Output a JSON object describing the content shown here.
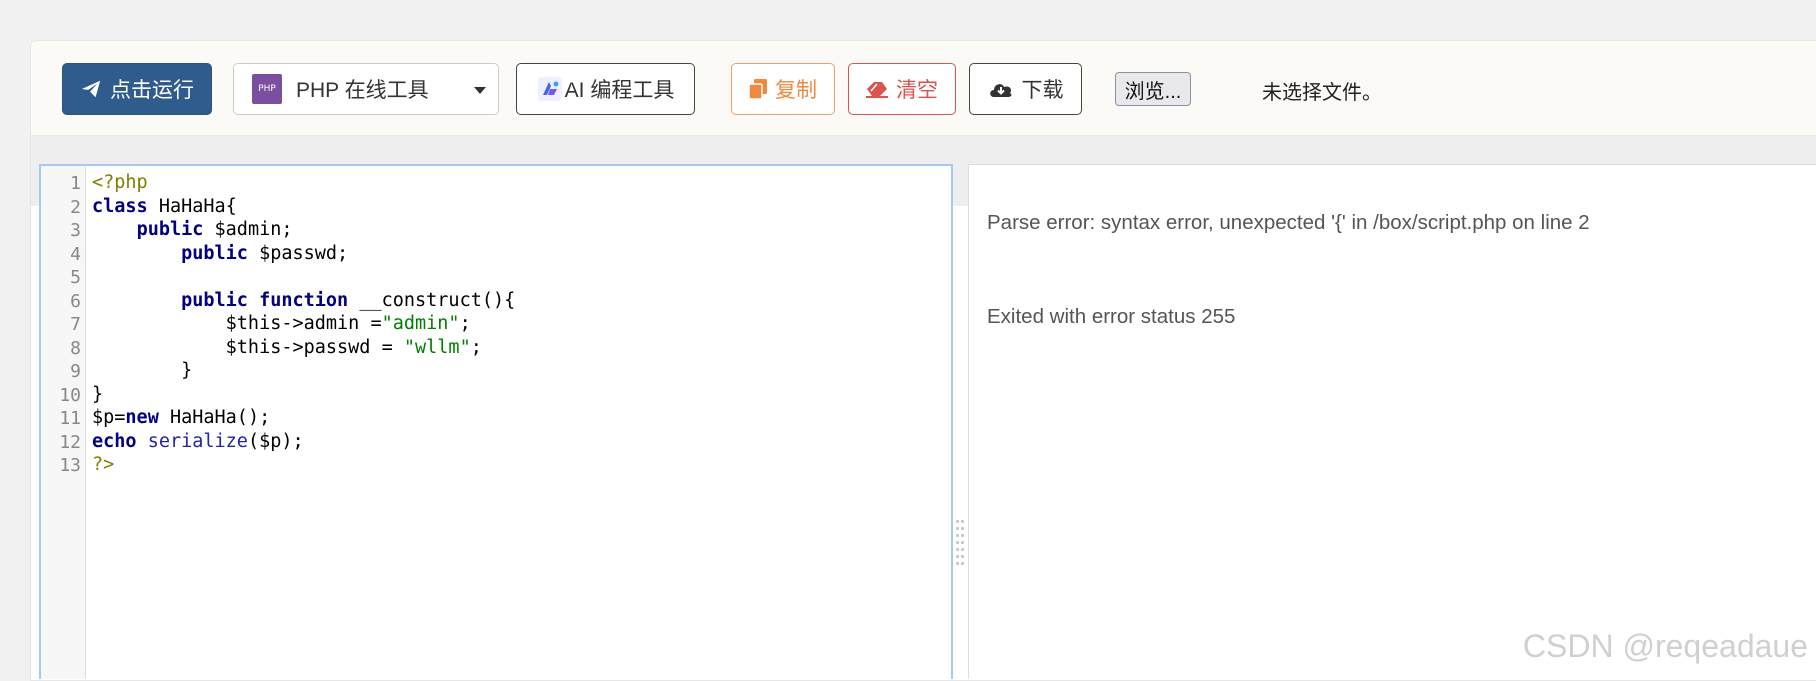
{
  "toolbar": {
    "run_label": "点击运行",
    "language_select": {
      "logo_text": "PHP",
      "selected": "PHP 在线工具"
    },
    "ai_label": "AI 编程工具",
    "copy_label": "复制",
    "clear_label": "清空",
    "download_label": "下载",
    "browse_label": "浏览...",
    "no_file_label": "未选择文件。"
  },
  "editor": {
    "line_numbers": [
      "1",
      "2",
      "3",
      "4",
      "5",
      "6",
      "7",
      "8",
      "9",
      "10",
      "11",
      "12",
      "13"
    ]
  },
  "output": {
    "error_line": "Parse error: syntax error, unexpected '{' in /box/script.php on line 2",
    "status_line": "Exited with error status 255"
  },
  "watermark": "CSDN @reqeadaue",
  "colors": {
    "run_button": "#2f5c8c",
    "copy_button": "#f0883e",
    "clear_button": "#d9534f",
    "editor_border": "#a8c8f0"
  }
}
